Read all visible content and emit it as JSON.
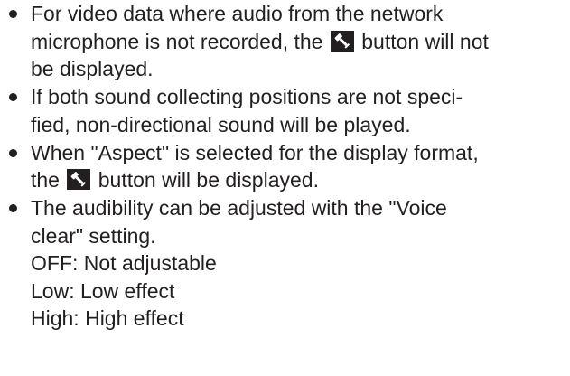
{
  "items": [
    {
      "lines": [
        "For video data where audio from the network",
        "microphone is not recorded, the ",
        " button will not",
        "be displayed."
      ],
      "icon_name": "microphone-icon"
    },
    {
      "lines": [
        "If both sound collecting positions are not speci-",
        "fied, non-directional sound will be played."
      ]
    },
    {
      "lines": [
        "When \"Aspect\" is selected for the display format,",
        "the ",
        " button will be displayed."
      ],
      "icon_name": "microphone-icon"
    },
    {
      "lines": [
        "The audibility can be adjusted with the \"Voice",
        "clear\" setting.",
        "OFF: Not adjustable",
        "Low: Low effect",
        "High: High effect"
      ]
    }
  ]
}
